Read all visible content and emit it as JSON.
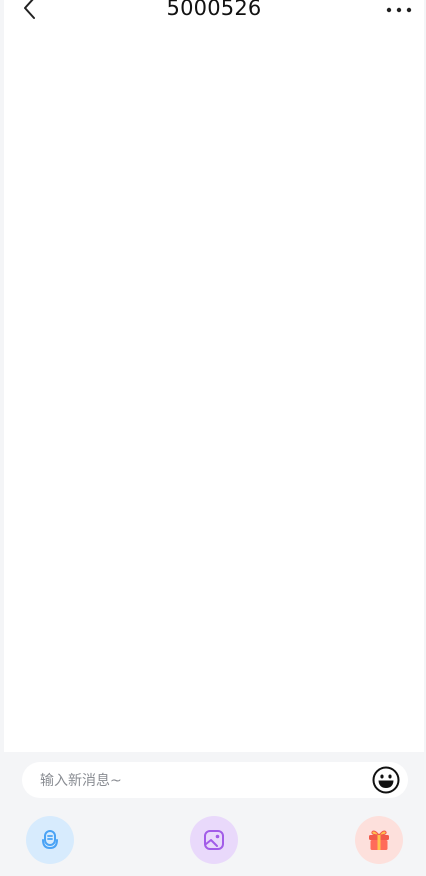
{
  "header": {
    "title": "5000526",
    "back_icon": "chevron-left-icon",
    "more_icon": "more-dots-icon"
  },
  "composer": {
    "placeholder": "输入新消息~",
    "value": "",
    "emoji_icon": "emoji-icon"
  },
  "actions": [
    {
      "name": "voice",
      "icon": "microphone-icon",
      "color": "#d7ebfd",
      "icon_color": "#4aa3f5"
    },
    {
      "name": "image",
      "icon": "image-icon",
      "color": "#e9d9fb",
      "icon_color": "#a25ce8"
    },
    {
      "name": "gift",
      "icon": "gift-icon",
      "color": "#fde0dc",
      "icon_color": "#f25a4a"
    }
  ],
  "colors": {
    "background": "#f4f5f7",
    "panel": "#ffffff"
  }
}
